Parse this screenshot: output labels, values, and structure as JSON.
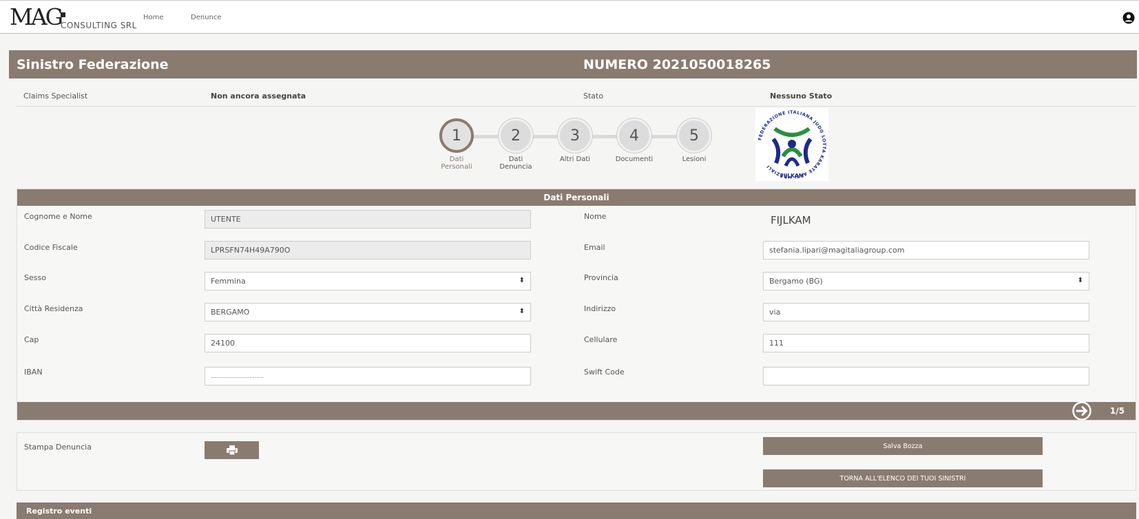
{
  "nav": {
    "logo_main": "MAG",
    "logo_sub": "CONSULTING SRL",
    "links": [
      "Home",
      "Denunce"
    ]
  },
  "header": {
    "title": "Sinistro Federazione",
    "number": "NUMERO 2021050018265"
  },
  "info": {
    "claims_label": "Claims Specialist",
    "claims_value": "Non ancora assegnata",
    "stato_label": "Stato",
    "stato_value": "Nessuno Stato"
  },
  "steps": [
    {
      "num": "1",
      "label_l1": "Dati",
      "label_l2": "Personali",
      "active": true
    },
    {
      "num": "2",
      "label_l1": "Dati",
      "label_l2": "Denuncia",
      "active": false
    },
    {
      "num": "3",
      "label_l1": "Altri Dati",
      "label_l2": "",
      "active": false
    },
    {
      "num": "4",
      "label_l1": "Documenti",
      "label_l2": "",
      "active": false
    },
    {
      "num": "5",
      "label_l1": "Lesioni",
      "label_l2": "",
      "active": false
    }
  ],
  "logo_fijlkam": {
    "ring_text": "FEDERAZIONE ITALIANA JUDO LOTTA KARATE ARTI MARZIALI",
    "name": "FIJLKAM"
  },
  "section": {
    "title": "Dati Personali",
    "page_indicator": "1/5",
    "fields": {
      "cognome_label": "Cognome e Nome",
      "cognome_value": "UTENTE",
      "nome_label": "Nome",
      "nome_value": "FIJLKAM",
      "cf_label": "Codice Fiscale",
      "cf_value": "LPRSFN74H49A790O",
      "email_label": "Email",
      "email_value": "stefania.lipari@magitaliagroup.com",
      "sesso_label": "Sesso",
      "sesso_value": "Femmina",
      "provincia_label": "Provincia",
      "provincia_value": "Bergamo (BG)",
      "citta_label": "Città Residenza",
      "citta_value": "BERGAMO",
      "indirizzo_label": "Indirizzo",
      "indirizzo_value": "via",
      "cap_label": "Cap",
      "cap_value": "24100",
      "cellulare_label": "Cellulare",
      "cellulare_value": "111",
      "iban_label": "IBAN",
      "iban_value": "..............................",
      "swift_label": "Swift Code",
      "swift_value": ""
    }
  },
  "actions": {
    "stampa_label": "Stampa Denuncia",
    "salva_label": "Salva Bozza",
    "torna_label": "TORNA ALL'ELENCO DEI TUOI SINISTRI"
  },
  "registro": {
    "title": "Registro eventi"
  },
  "colors": {
    "brand_brown": "#8a7b70",
    "fijlkam_blue": "#1d2a8c",
    "fijlkam_green": "#2a8f3e"
  }
}
